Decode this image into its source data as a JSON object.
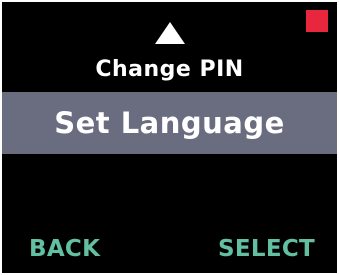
{
  "indicator": {
    "color": "#e8263e"
  },
  "navigation": {
    "up_icon": "triangle-up-icon"
  },
  "menu": {
    "previous_item": "Change PIN",
    "selected_item": "Set Language"
  },
  "softkeys": {
    "left_label": "BACK",
    "right_label": "SELECT",
    "color": "#63bfa1"
  },
  "colors": {
    "background": "#000000",
    "highlight": "#6a6d80",
    "text": "#ffffff"
  }
}
